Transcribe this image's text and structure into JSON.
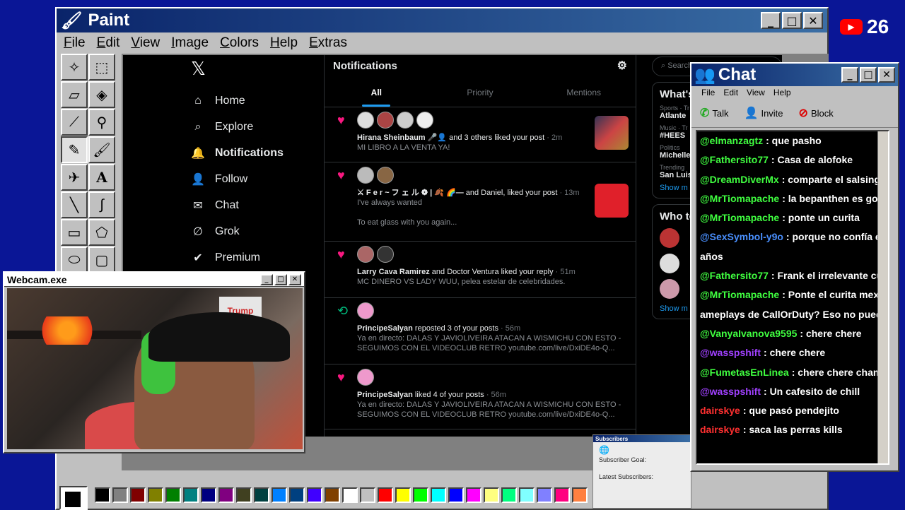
{
  "paint": {
    "title": "Paint",
    "menu": [
      "File",
      "Edit",
      "View",
      "Image",
      "Colors",
      "Help",
      "Extras"
    ],
    "palette": [
      "#000000",
      "#808080",
      "#800000",
      "#808000",
      "#008000",
      "#008080",
      "#000080",
      "#800080",
      "#404020",
      "#004040",
      "#0080ff",
      "#004080",
      "#4000ff",
      "#804000",
      "#ffffff",
      "#c0c0c0",
      "#ff0000",
      "#ffff00",
      "#00ff00",
      "#00ffff",
      "#0000ff",
      "#ff00ff",
      "#ffff80",
      "#00ff80",
      "#80ffff",
      "#8080ff",
      "#ff0080",
      "#ff8040"
    ]
  },
  "youtube": {
    "count": "26"
  },
  "x": {
    "nav": [
      {
        "icon": "⌂",
        "label": "Home"
      },
      {
        "icon": "⌕",
        "label": "Explore"
      },
      {
        "icon": "🔔",
        "label": "Notifications"
      },
      {
        "icon": "👤",
        "label": "Follow"
      },
      {
        "icon": "✉",
        "label": "Chat"
      },
      {
        "icon": "∅",
        "label": "Grok"
      },
      {
        "icon": "✔",
        "label": "Premium"
      }
    ],
    "header": "Notifications",
    "tabs": [
      "All",
      "Priority",
      "Mentions"
    ],
    "notifications": [
      {
        "type": "like",
        "actor": "Hirana Sheinbaum",
        "rest": " 🎤👤 and 3 others liked your post",
        "time": " · 2m",
        "sub": "MI LIBRO A LA VENTA YA!",
        "sub2": ""
      },
      {
        "type": "like",
        "actor": "⚔ F e r ~ フ ェ ル ❁ | 🍂 🌈—",
        "rest": " and Daniel, liked your post",
        "time": " · 13m",
        "sub": "I've always wanted",
        "sub2": "To eat glass with you again..."
      },
      {
        "type": "like",
        "actor": "Larry Cava Ramirez",
        "rest": " and Doctor Ventura liked your reply",
        "time": " · 51m",
        "sub": "MC DINERO VS LADY WUU, pelea estelar de celebridades.",
        "sub2": ""
      },
      {
        "type": "repost",
        "actor": "PrincipeSalyan",
        "rest": " reposted 3 of your posts",
        "time": " · 56m",
        "sub": "Ya en directo: DALAS Y JAVIOLIVEIRA ATACAN A WISMICHU CON ESTO -",
        "sub2": "SEGUIMOS CON EL VIDEOCLUB RETRO youtube.com/live/DxiDE4o-Q..."
      },
      {
        "type": "like",
        "actor": "PrincipeSalyan",
        "rest": " liked 4 of your posts",
        "time": " · 56m",
        "sub": "Ya en directo: DALAS Y JAVIOLIVEIRA ATACAN A WISMICHU CON ESTO -",
        "sub2": "SEGUIMOS CON EL VIDEOCLUB RETRO youtube.com/live/DxiDE4o-Q..."
      }
    ],
    "right": {
      "search": "Search",
      "trending_title": "What's",
      "t1_cat": "Sports · Tr",
      "t1": "Atlante",
      "t2_cat": "Music · Tr",
      "t2": "#HEES",
      "t3_cat": "Politics",
      "t3": "Michelle",
      "t4_cat": "Trending",
      "t4": "San Luis",
      "show_more": "Show m",
      "who": "Who to",
      "show_more2": "Show m"
    }
  },
  "webcam": {
    "title": "Webcam.exe",
    "box_text": "Trump"
  },
  "chat": {
    "title": "Chat",
    "menu": [
      "File",
      "Edit",
      "View",
      "Help"
    ],
    "tools": [
      "Talk",
      "Invite",
      "Block"
    ],
    "messages": [
      {
        "u": "@elmanzagtz",
        "c": "#40ff40",
        "m": ": que pasho"
      },
      {
        "u": "@Fathersito77",
        "c": "#40ff40",
        "m": ": Casa de alofoke"
      },
      {
        "u": "@DreamDiverMx",
        "c": "#40ff40",
        "m": ": comparte el salsing, la m"
      },
      {
        "u": "@MrTiomapache",
        "c": "#40ff40",
        "m": ": la bepanthen es god"
      },
      {
        "u": "@MrTiomapache",
        "c": "#40ff40",
        "m": ": ponte un curita"
      },
      {
        "u": "@SexSymbol-y9o",
        "c": "#4a90ff",
        "m": ": porque no confía en el si"
      },
      {
        "u": "",
        "c": "#fff",
        "m": "años"
      },
      {
        "u": "@Fathersito77",
        "c": "#40ff40",
        "m": ": Frank el irrelevante cuesta"
      },
      {
        "u": "@MrTiomapache",
        "c": "#40ff40",
        "m": ": Ponte el curita mexi, si se"
      },
      {
        "u": "",
        "c": "#fff",
        "m": "ameplays de CallOrDuty? Eso no puede pasar"
      },
      {
        "u": "@VanyaIvanova9595",
        "c": "#40ff40",
        "m": ": chere chere"
      },
      {
        "u": "@wasspshift",
        "c": "#a040ff",
        "m": ": chere chere"
      },
      {
        "u": "@FumetasEnLinea",
        "c": "#40ff40",
        "m": ": chere chere chamo wer"
      },
      {
        "u": "@wasspshift",
        "c": "#a040ff",
        "m": ": Un cafesito de chill"
      },
      {
        "u": "dairskye",
        "c": "#ff3030",
        "m": ": que pasó pendejito"
      },
      {
        "u": "dairskye",
        "c": "#ff3030",
        "m": ": saca las perras kills"
      }
    ]
  },
  "subscribers": {
    "title": "Subscribers",
    "goal": "Subscriber Goal:",
    "latest": "Latest Subscribers:"
  }
}
